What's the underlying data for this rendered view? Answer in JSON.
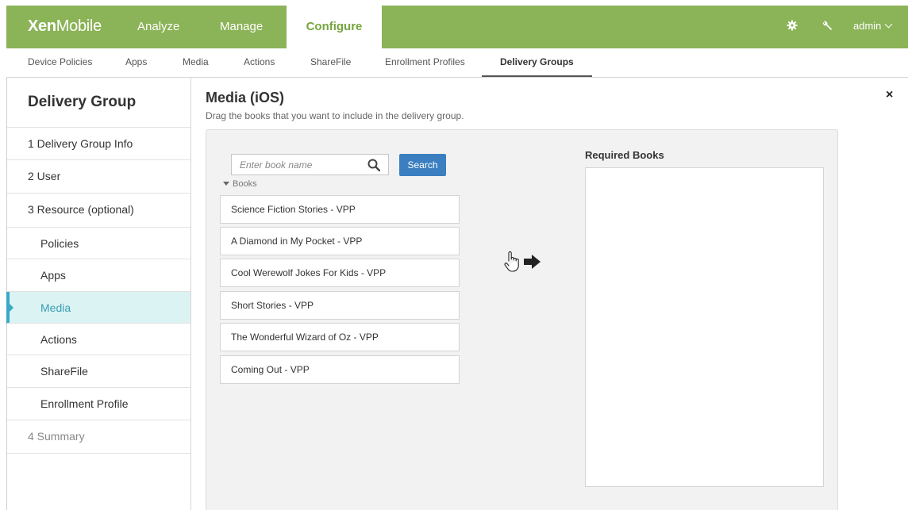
{
  "app": {
    "logo_bold": "Xen",
    "logo_thin": "Mobile"
  },
  "topnav": {
    "analyze": "Analyze",
    "manage": "Manage",
    "configure": "Configure",
    "admin": "admin"
  },
  "subnav": [
    "Device Policies",
    "Apps",
    "Media",
    "Actions",
    "ShareFile",
    "Enrollment Profiles",
    "Delivery Groups"
  ],
  "sidebar": {
    "title": "Delivery Group",
    "items": [
      "1  Delivery Group Info",
      "2  User",
      "3  Resource (optional)",
      "Policies",
      "Apps",
      "Media",
      "Actions",
      "ShareFile",
      "Enrollment Profile",
      "4  Summary"
    ],
    "active_item": "Media"
  },
  "main": {
    "title": "Media (iOS)",
    "subtitle": "Drag the books that you want to include in the delivery group.",
    "close": "×"
  },
  "search": {
    "placeholder": "Enter book name",
    "value": "",
    "button_label": "Search"
  },
  "books": {
    "group_label": "Books",
    "items": [
      "Science Fiction Stories - VPP",
      "A Diamond in My Pocket - VPP",
      "Cool Werewolf Jokes For Kids - VPP",
      "Short Stories - VPP",
      "The Wonderful Wizard of Oz - VPP",
      "Coming Out - VPP"
    ]
  },
  "required": {
    "label": "Required Books"
  },
  "icons": {
    "gear": "gear-icon",
    "wrench": "wrench-icon",
    "search": "search-icon",
    "drag": "hand-pointer-icon",
    "arrow": "arrow-right-icon",
    "close": "close-icon"
  },
  "colors": {
    "topbar": "#8bb357",
    "configure_text": "#76a53f",
    "search_button": "#3b7fc0",
    "active_sidebar_bg": "#dbf3f2",
    "active_sidebar_text": "#3a9db5"
  }
}
